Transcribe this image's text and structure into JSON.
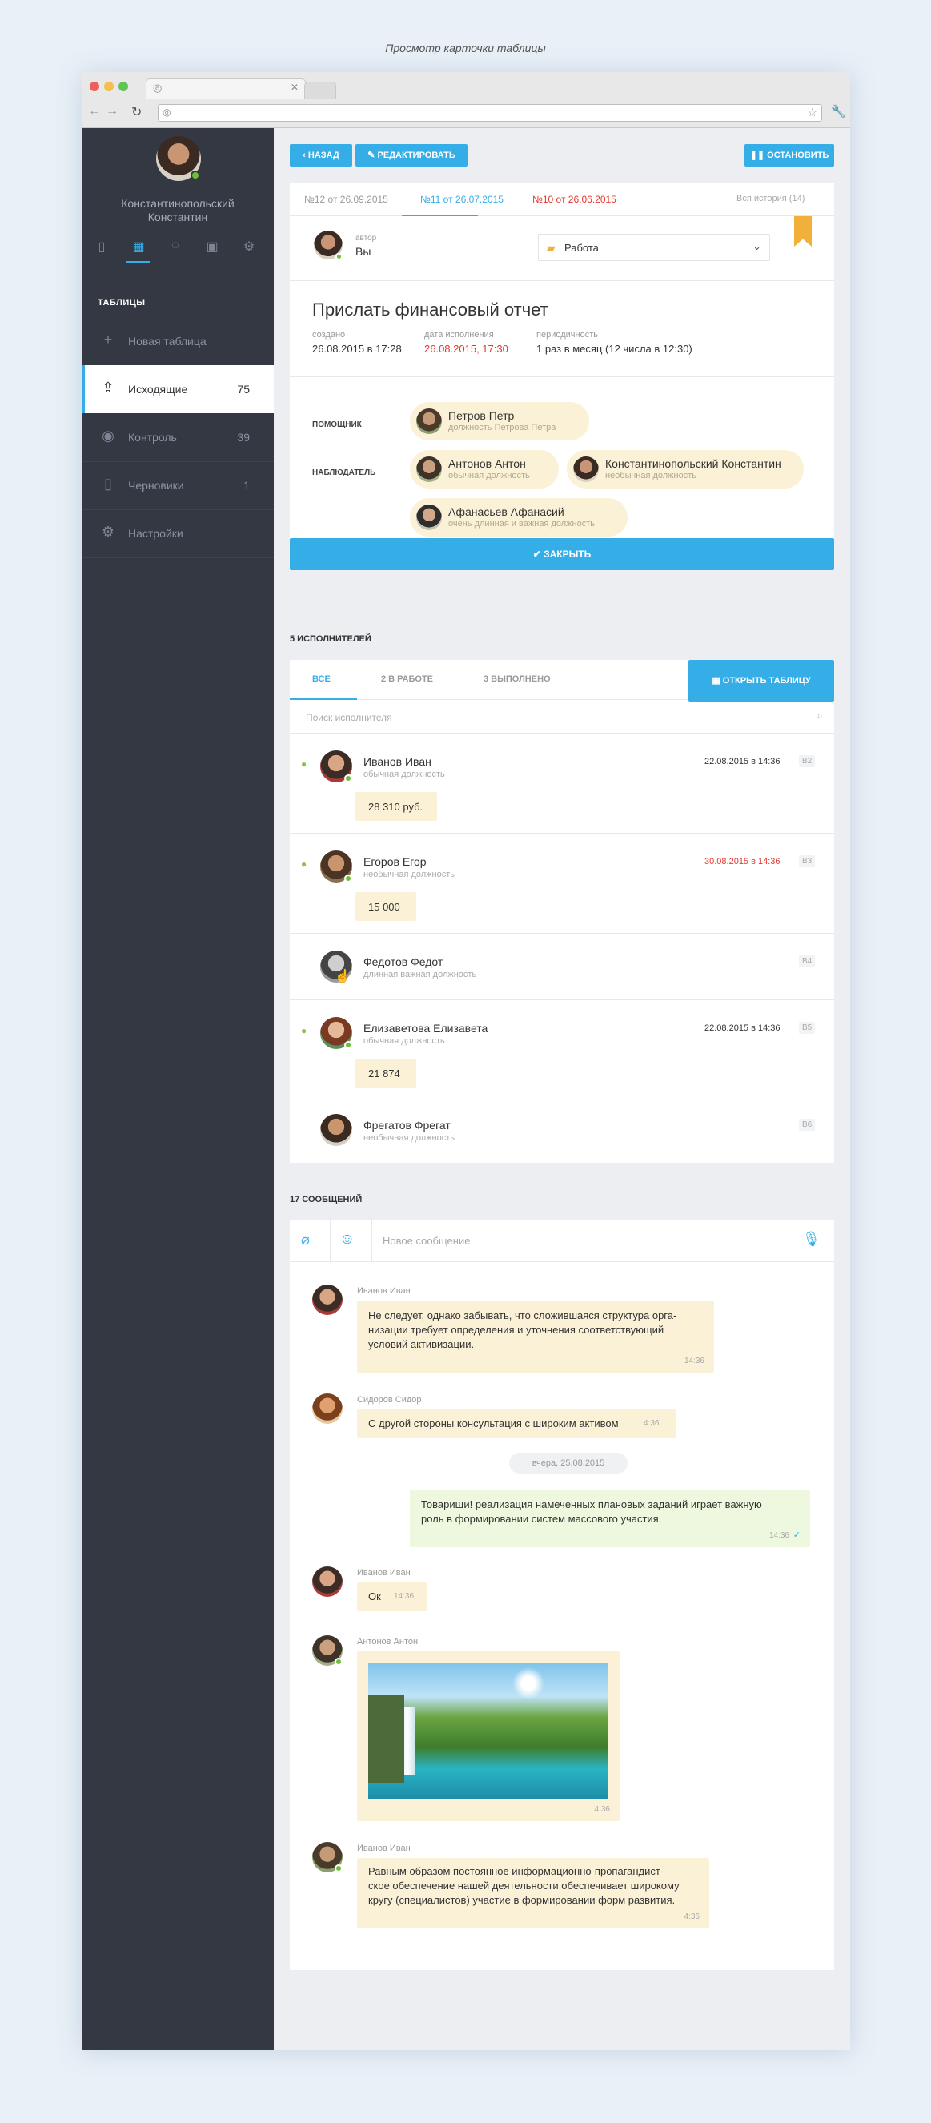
{
  "caption": "Просмотр карточки таблицы",
  "sidebar": {
    "user_name_line1": "Константинопольский",
    "user_name_line2": "Константин",
    "section_title": "ТАБЛИЦЫ",
    "items": [
      {
        "label": "Новая таблица",
        "count": ""
      },
      {
        "label": "Исходящие",
        "count": "75"
      },
      {
        "label": "Контроль",
        "count": "39"
      },
      {
        "label": "Черновики",
        "count": "1"
      },
      {
        "label": "Настройки",
        "count": ""
      }
    ]
  },
  "toolbar": {
    "back": "НАЗАД",
    "edit": "РЕДАКТИРОВАТЬ",
    "stop": "ОСТАНОВИТЬ"
  },
  "history": {
    "tabs": [
      "№12 от 26.09.2015",
      "№11 от 26.07.2015",
      "№10 от 26.06.2015"
    ],
    "all": "Вся история (14)"
  },
  "author": {
    "label": "автор",
    "name": "Вы",
    "folder": "Работа"
  },
  "task": {
    "title": "Прислать финансовый отчет",
    "created_label": "создано",
    "created": "26.08.2015 в 17:28",
    "due_label": "дата исполнения",
    "due": "26.08.2015, 17:30",
    "period_label": "периодичность",
    "period": "1 раз в месяц (12 числа в 12:30)"
  },
  "people": {
    "helper_label": "ПОМОЩНИК",
    "observer_label": "НАБЛЮДАТЕЛЬ",
    "helper": {
      "name": "Петров Петр",
      "position": "должность Петрова Петра"
    },
    "observers": [
      {
        "name": "Антонов Антон",
        "position": "обычная должность"
      },
      {
        "name": "Константинопольский Константин",
        "position": "необычная должность"
      },
      {
        "name": "Афанасьев Афанасий",
        "position": "очень длинная и важная должность"
      }
    ]
  },
  "close_button": "ЗАКРЫТЬ",
  "executors": {
    "heading": "5 ИСПОЛНИТЕЛЕЙ",
    "tabs": [
      "ВСЕ",
      "2 В РАБОТЕ",
      "3 ВЫПОЛНЕНО"
    ],
    "open_table": "ОТКРЫТЬ ТАБЛИЦУ",
    "search_placeholder": "Поиск исполнителя",
    "rows": [
      {
        "name": "Иванов Иван",
        "position": "обычная должность",
        "date": "22.08.2015 в 14:36",
        "cell": "B2",
        "value": "28 310 руб.",
        "done": true,
        "late": false
      },
      {
        "name": "Егоров Егор",
        "position": "необычная должность",
        "date": "30.08.2015 в 14:36",
        "cell": "B3",
        "value": "15 000",
        "done": true,
        "late": true
      },
      {
        "name": "Федотов Федот",
        "position": "длинная важная должность",
        "date": "",
        "cell": "B4",
        "value": "",
        "done": false,
        "late": false
      },
      {
        "name": "Елизаветова Елизавета",
        "position": "обычная должность",
        "date": "22.08.2015 в 14:36",
        "cell": "B5",
        "value": "21 874",
        "done": true,
        "late": false
      },
      {
        "name": "Фрегатов Фрегат",
        "position": "необычная должность",
        "date": "",
        "cell": "B6",
        "value": "",
        "done": false,
        "late": false
      }
    ]
  },
  "messages": {
    "heading": "17 СООБЩЕНИЙ",
    "placeholder": "Новое сообщение",
    "date_divider": "вчера, 25.08.2015",
    "items": [
      {
        "author": "Иванов Иван",
        "text1": "Не следует, однако забывать, что сложившаяся структура орга-",
        "text2": "низации требует определения и уточнения соответствующий",
        "text3": "условий активизации.",
        "time": "14:36"
      },
      {
        "author": "Сидоров Сидор",
        "text1": "С другой стороны консультация с широким активом",
        "time": "4:36"
      },
      {
        "author": "",
        "text1": "Товарищи! реализация намеченных плановых заданий играет важную",
        "text2": "роль в формировании систем массового участия.",
        "time": "14:36"
      },
      {
        "author": "Иванов Иван",
        "text1": "Ок",
        "time": "14:36"
      },
      {
        "author": "Антонов Антон",
        "time": "4:36"
      },
      {
        "author": "Иванов Иван",
        "text1": "Равным образом постоянное информационно-пропагандист-",
        "text2": "ское обеспечение нашей деятельности обеспечивает широкому",
        "text3": "кругу (специалистов) участие в формировании форм развития.",
        "time": "4:36"
      }
    ]
  },
  "colors": {
    "accent": "#35aee8",
    "sidebar": "#343843",
    "danger": "#e5382e",
    "chip": "#fbf1d7",
    "done": "#8cc24b"
  }
}
